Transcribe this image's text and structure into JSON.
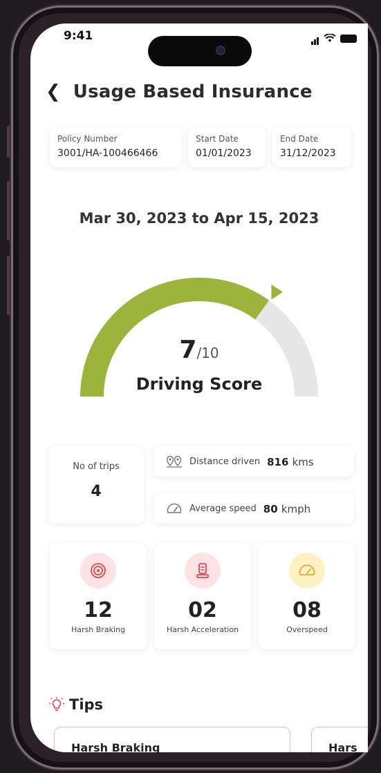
{
  "status_bar": {
    "time": "9:41"
  },
  "header": {
    "title": "Usage Based Insurance"
  },
  "policy": [
    {
      "label": "Policy Number",
      "value": "3001/HA-100466466"
    },
    {
      "label": "Start Date",
      "value": "01/01/2023"
    },
    {
      "label": "End Date",
      "value": "31/12/2023"
    }
  ],
  "date_range": "Mar 30, 2023 to Apr 15, 2023",
  "score": {
    "value": "7",
    "denominator": "/10",
    "label": "Driving Score",
    "fraction": 0.7
  },
  "stats": {
    "trips_label": "No of trips",
    "trips_value": "4",
    "distance_label": "Distance driven",
    "distance_value": "816",
    "distance_unit": "kms",
    "speed_label": "Average speed",
    "speed_value": "80",
    "speed_unit": "kmph"
  },
  "events": [
    {
      "value": "12",
      "label": "Harsh Braking",
      "icon": "brake-disc-icon"
    },
    {
      "value": "02",
      "label": "Harsh Acceleration",
      "icon": "accelerator-pedal-icon"
    },
    {
      "value": "08",
      "label": "Overspeed",
      "icon": "speedometer-icon"
    }
  ],
  "tips": {
    "title": "Tips",
    "cards": [
      {
        "label": "Harsh Braking"
      },
      {
        "label": "Hars"
      }
    ]
  },
  "colors": {
    "gauge_fill": "#9cb43c",
    "gauge_track": "#e6e6e6",
    "event_red_bg": "#fde3e4",
    "event_red": "#e0474f",
    "event_yellow_bg": "#fff1c4",
    "event_yellow": "#e6a82b"
  }
}
